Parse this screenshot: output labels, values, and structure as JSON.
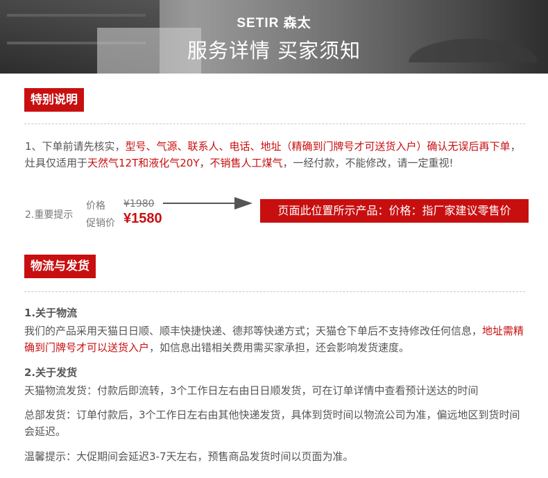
{
  "banner": {
    "brand": "SETIR 森太",
    "title": "服务详情 买家须知"
  },
  "special": {
    "heading": "特别说明",
    "item1": {
      "prefix": "1、下单前请先核实，",
      "red1": "型号、气源、联系人、电话、地址（精确到门牌号才可送货入户）确认无误后再下单",
      "mid": "，灶具仅适用于",
      "red2": "天然气12T和液化气20Y，不销售人工煤气",
      "suffix": "，一经付款，不能修改，请一定重视!"
    },
    "item2_label": "2.重要提示",
    "price_label": "价格",
    "price_old": "¥1980",
    "promo_label": "促销价",
    "price_new": "¥1580",
    "notice": "页面此位置所示产品：价格：指厂家建议零售价"
  },
  "logistics": {
    "heading": "物流与发货",
    "sub1": "1.关于物流",
    "sub1_text_a": "我们的产品采用天猫日日顺、顺丰快捷快递、德邦等快递方式；天猫仓下单后不支持修改任何信息，",
    "sub1_text_red": "地址需精确到门牌号才可以送货入户",
    "sub1_text_b": "，如信息出错相关费用需买家承担，还会影响发货速度。",
    "sub2": "2.关于发货",
    "line1": "天猫物流发货：付款后即流转，3个工作日左右由日日顺发货，可在订单详情中查看预计送达的时间",
    "line2": "总部发货：订单付款后，3个工作日左右由其他快递发货，具体到货时间以物流公司为准，偏远地区到货时间会延迟。",
    "line3": "温馨提示：大促期间会延迟3-7天左右，预售商品发货时间以页面为准。"
  }
}
